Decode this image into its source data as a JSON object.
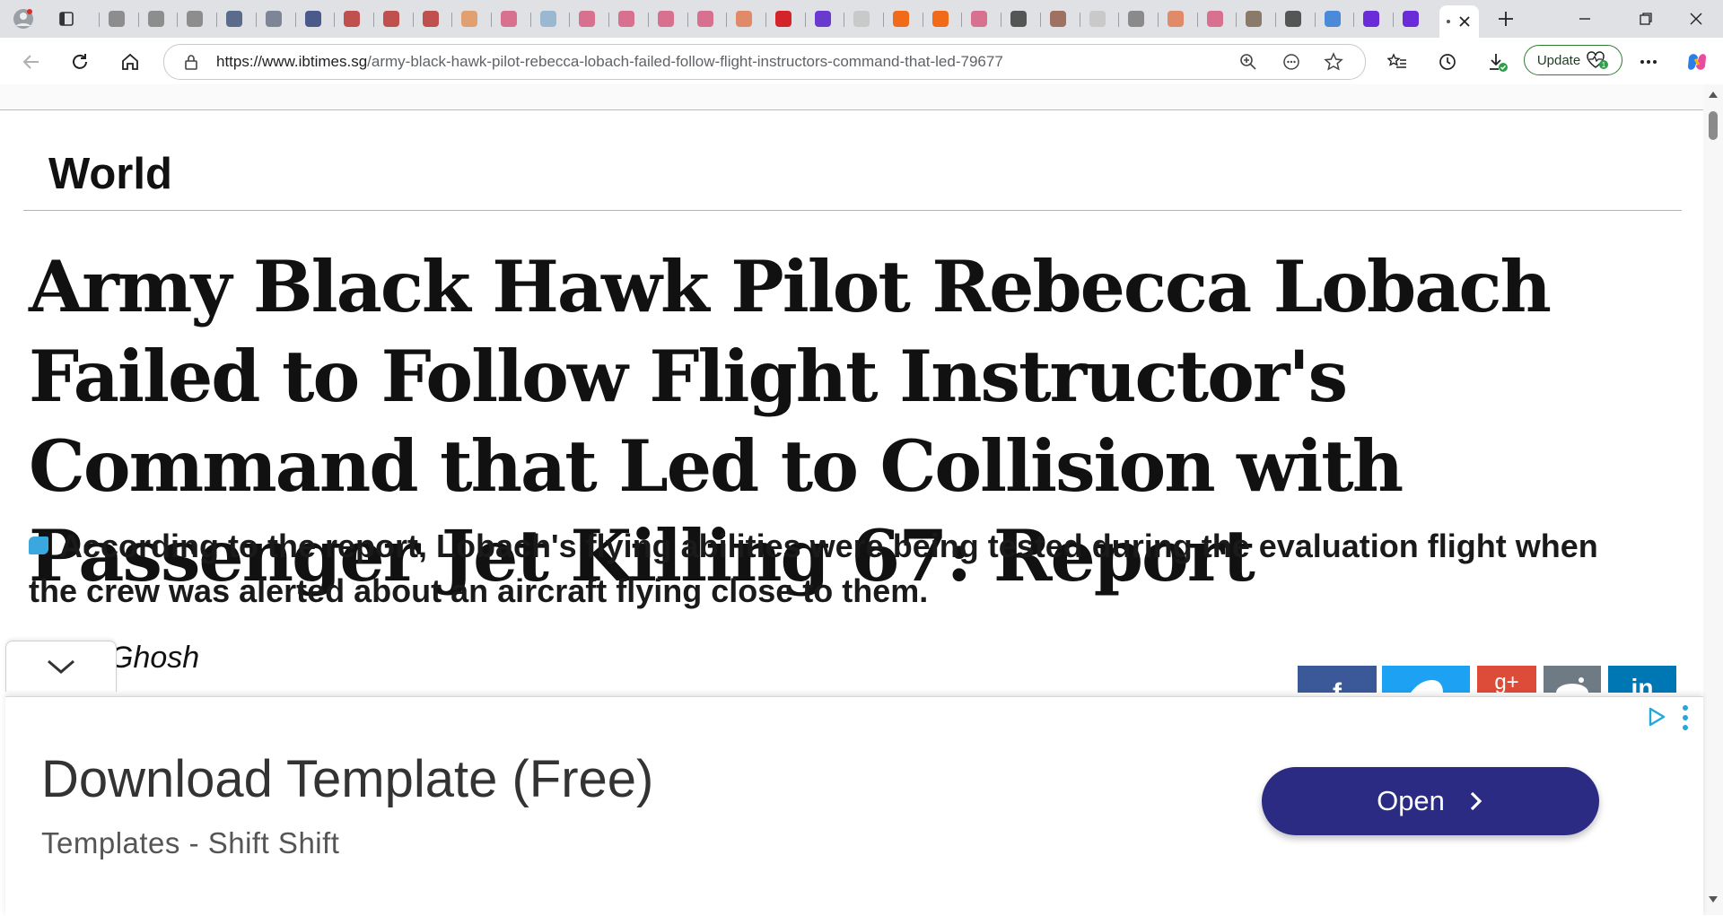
{
  "browser": {
    "url_domain": "https://www.ibtimes.sg",
    "url_path": "/army-black-hawk-pilot-rebecca-lobach-failed-follow-flight-instructors-command-that-led-79677",
    "update_label": "Update",
    "tab_favicon_colors": [
      "#8d8d8d",
      "#8d8d8d",
      "#8d8d8d",
      "#5a6b8c",
      "#7d8596",
      "#4a5a8a",
      "#c0504d",
      "#c0504d",
      "#c0504d",
      "#e0a070",
      "#d87090",
      "#9ab8d0",
      "#d87090",
      "#d87090",
      "#d87090",
      "#d87090",
      "#e08a6a",
      "#d4242a",
      "#6a3ad0",
      "#c9c9c9",
      "#f06a1a",
      "#f06a1a",
      "#d87090",
      "#555555",
      "#a07060",
      "#c9c9c9",
      "#8a8a8a",
      "#e08a6a",
      "#d87090",
      "#8a7a6a",
      "#555555",
      "#4a8ad8",
      "#6a2bd9",
      "#6a2bd9"
    ]
  },
  "article": {
    "section": "World",
    "headline": "Army Black Hawk Pilot Rebecca Lobach Failed to Follow Flight Instructor's Command that Led to Collision with Passenger Jet Killing 67: Report",
    "summary": "According to the report, Lobach's flying abilities were being tested during the evaluation flight when the crew was alerted about an aircraft flying close to them.",
    "author_visible": "Ghosh",
    "social_colors": {
      "facebook": "#3b5998",
      "twitter": "#1da1f2",
      "googleplus": "#dd4b39",
      "reddit": "#6e7b85",
      "linkedin": "#0077b5"
    }
  },
  "ad": {
    "title": "Download Template (Free)",
    "subtitle": "Templates - Shift Shift",
    "button_label": "Open",
    "button_color": "#2b2b84"
  }
}
